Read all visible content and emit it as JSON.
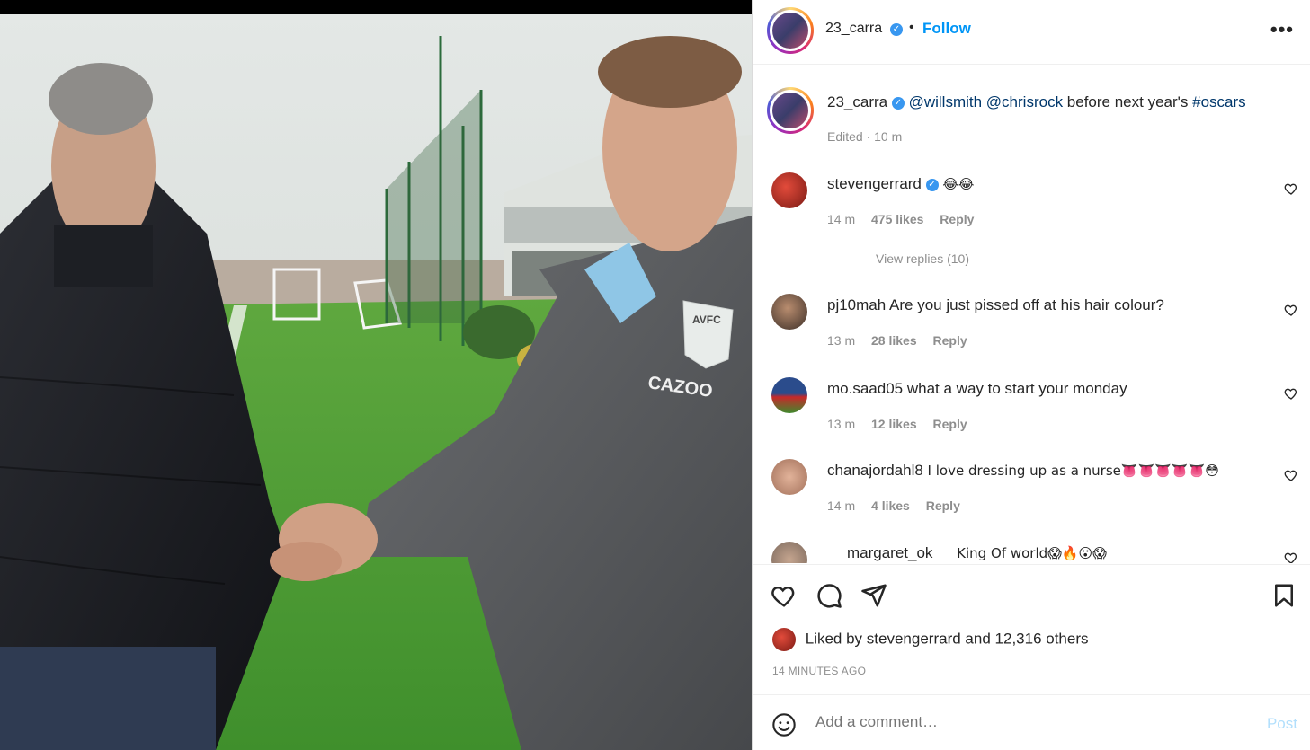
{
  "post": {
    "author": "23_carra",
    "follow_label": "Follow",
    "separator": "•",
    "more_label": "•••"
  },
  "caption": {
    "username": "23_carra",
    "mention1": "@willsmith",
    "mention2": "@chrisrock",
    "text": "before next year's",
    "hashtag": "#oscars",
    "meta": "Edited · 10 m"
  },
  "comments": [
    {
      "username": "stevengerrard",
      "verified": true,
      "text": "😂😂",
      "time": "14 m",
      "likes": "475 likes",
      "reply": "Reply",
      "view_replies": "View replies (10)"
    },
    {
      "username": "pj10mah",
      "verified": false,
      "text": "Are you just pissed off at his hair colour?",
      "time": "13 m",
      "likes": "28 likes",
      "reply": "Reply"
    },
    {
      "username": "mo.saad05",
      "verified": false,
      "text": "what a way to start your monday",
      "time": "13 m",
      "likes": "12 likes",
      "reply": "Reply"
    },
    {
      "username": "chanajordahl8",
      "verified": false,
      "text": "I love dressing up as a nurse👅👅👅👅👅😳",
      "time": "14 m",
      "likes": "4 likes",
      "reply": "Reply"
    },
    {
      "username": "margaret_ok",
      "verified": false,
      "text": "King Of world😱🔥😮😱",
      "time": "",
      "likes": "",
      "reply": ""
    }
  ],
  "likes": {
    "prefix": "Liked by",
    "user": "stevengerrard",
    "middle": "and",
    "others": "12,316 others"
  },
  "timestamp": "14 MINUTES AGO",
  "add_comment": {
    "placeholder": "Add a comment…",
    "post_label": "Post"
  },
  "photo": {
    "shirt_text": "CAZOO",
    "badge_text": "AVFC"
  },
  "colors": {
    "accent": "#0095f6",
    "verified": "#3897f0",
    "muted": "#8e8e8e",
    "post_disabled": "#b2dffc"
  }
}
